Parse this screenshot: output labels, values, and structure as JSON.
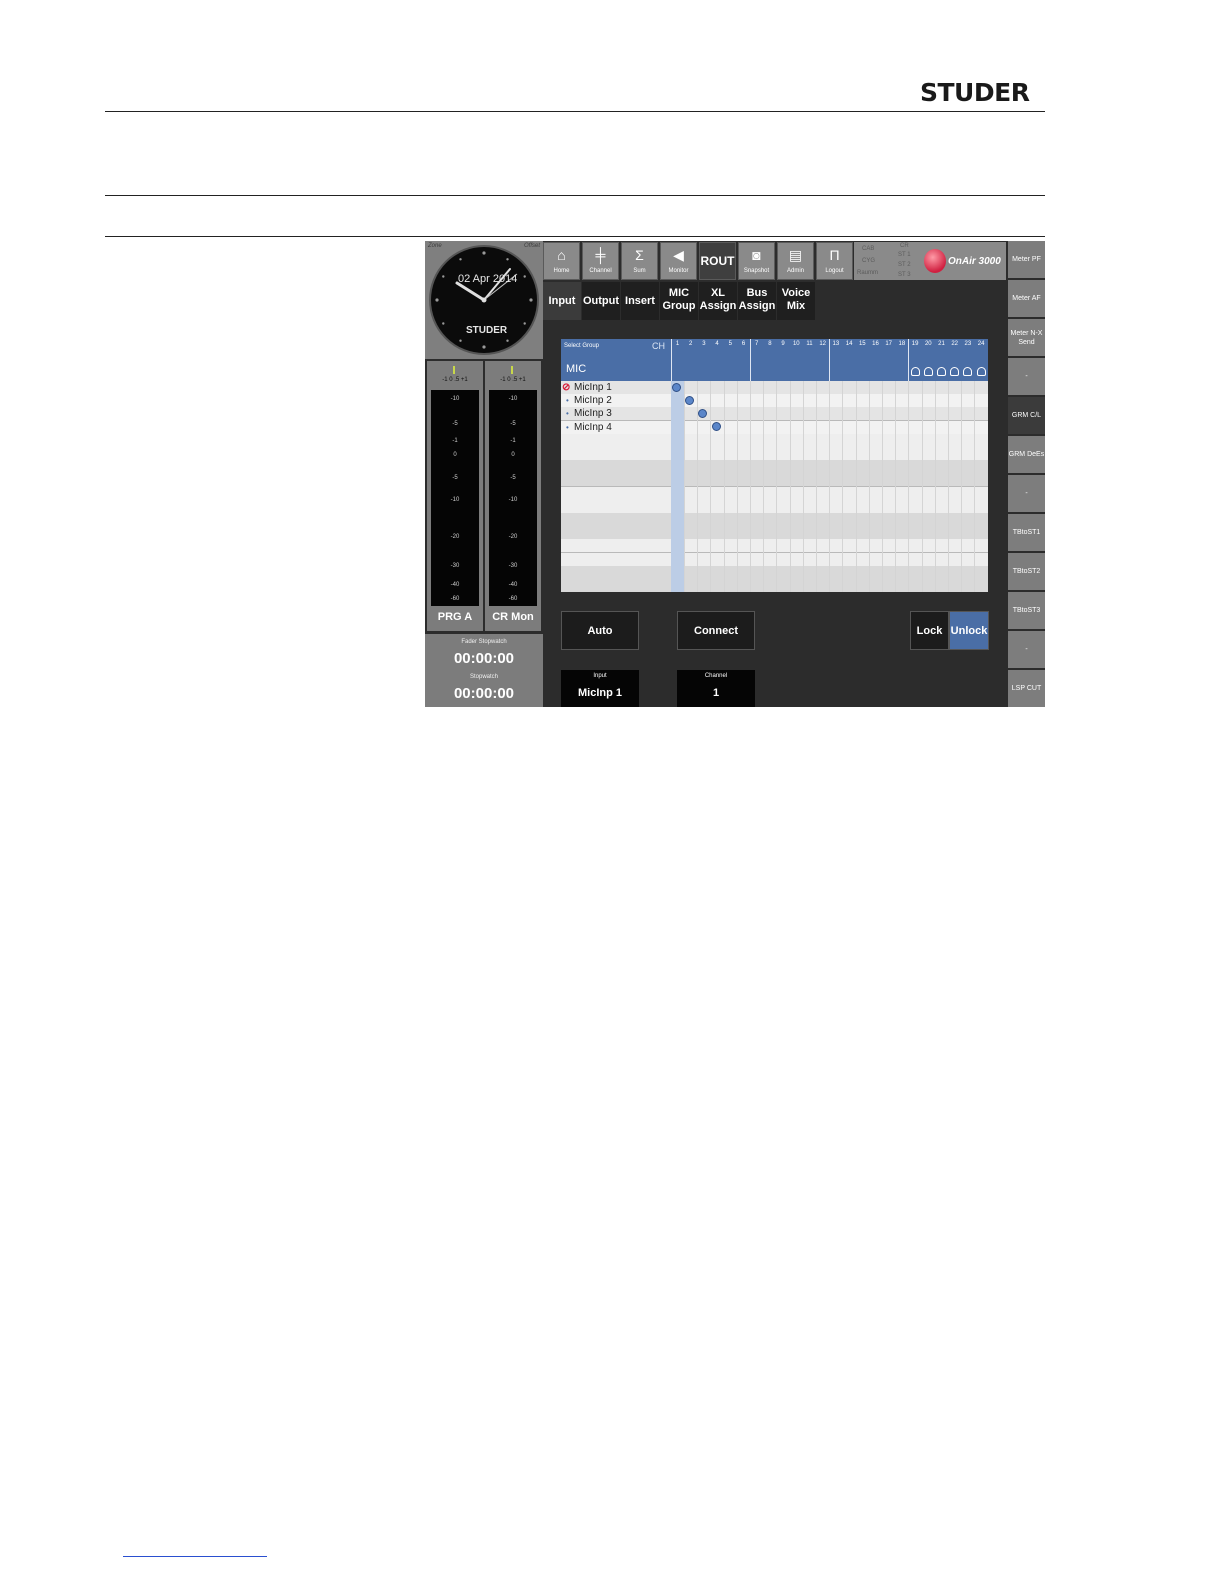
{
  "header": {
    "brand": "STUDER"
  },
  "clock": {
    "date": "02 Apr 2014",
    "brand": "STUDER",
    "corner_left": "Zone",
    "corner_right": "Offset"
  },
  "meters": [
    {
      "label": "PRG A",
      "scale_head": "-1  0  .5  +1",
      "ticks": [
        "-10",
        "-5",
        "-1",
        "0",
        "-5",
        "-10",
        "-20",
        "-30",
        "-40",
        "-60"
      ]
    },
    {
      "label": "CR Mon",
      "scale_head": "-1  0  .5  +1",
      "ticks": [
        "-10",
        "-5",
        "-1",
        "0",
        "-5",
        "-10",
        "-20",
        "-30",
        "-40",
        "-60"
      ]
    }
  ],
  "stopwatch": {
    "fader_caption": "Fader Stopwatch",
    "fader_time": "00:00:00",
    "caption": "Stopwatch",
    "time": "00:00:00"
  },
  "toolbar": {
    "items": [
      {
        "label": "Home",
        "glyph": "⌂"
      },
      {
        "label": "Channel",
        "glyph": "╪"
      },
      {
        "label": "Sum",
        "glyph": "Σ"
      },
      {
        "label": "Monitor",
        "glyph": "◀"
      },
      {
        "label": "ROUT",
        "glyph": ""
      },
      {
        "label": "Snapshot",
        "glyph": "◙"
      },
      {
        "label": "Admin",
        "glyph": "▤"
      },
      {
        "label": "Logout",
        "glyph": "Π"
      }
    ],
    "status_left": [
      "CAB",
      "CYG",
      "Raumm"
    ],
    "status_right": [
      "CR",
      "ST 1",
      "ST 2",
      "ST 3"
    ],
    "product": "OnAir 3000"
  },
  "tabs": [
    {
      "line1": "Input",
      "line2": ""
    },
    {
      "line1": "Output",
      "line2": ""
    },
    {
      "line1": "Insert",
      "line2": ""
    },
    {
      "line1": "MIC",
      "line2": "Group"
    },
    {
      "line1": "XL",
      "line2": "Assign"
    },
    {
      "line1": "Bus",
      "line2": "Assign"
    },
    {
      "line1": "Voice",
      "line2": "Mix"
    }
  ],
  "sidebar": [
    {
      "label": "Meter PF"
    },
    {
      "label": "Meter AF"
    },
    {
      "label": "Meter N-X Send"
    },
    {
      "label": "-"
    },
    {
      "label": "GRM C/L"
    },
    {
      "label": "GRM DeEs"
    },
    {
      "label": "-"
    },
    {
      "label": "TBtoST1"
    },
    {
      "label": "TBtoST2"
    },
    {
      "label": "TBtoST3"
    },
    {
      "label": "-"
    },
    {
      "label": "LSP CUT"
    }
  ],
  "matrix": {
    "select_group": "Select Group",
    "group": "MIC",
    "ch_label": "CH",
    "channels": [
      "1",
      "2",
      "3",
      "4",
      "5",
      "6",
      "7",
      "8",
      "9",
      "10",
      "11",
      "12",
      "13",
      "14",
      "15",
      "16",
      "17",
      "18",
      "19",
      "20",
      "21",
      "22",
      "23",
      "24"
    ],
    "rows": [
      "MicInp 1",
      "MicInp 2",
      "MicInp 3",
      "MicInp 4"
    ],
    "connections": [
      {
        "input": "MicInp 1",
        "channel": 1
      },
      {
        "input": "MicInp 2",
        "channel": 2
      },
      {
        "input": "MicInp 3",
        "channel": 3
      },
      {
        "input": "MicInp 4",
        "channel": 4
      }
    ]
  },
  "buttons": {
    "auto": "Auto",
    "connect": "Connect",
    "lock": "Lock",
    "unlock": "Unlock"
  },
  "selection": {
    "input_caption": "Input",
    "input_value": "MicInp 1",
    "channel_caption": "Channel",
    "channel_value": "1"
  },
  "colors": {
    "accent": "#4a6ea6",
    "onair": "#d02040"
  }
}
